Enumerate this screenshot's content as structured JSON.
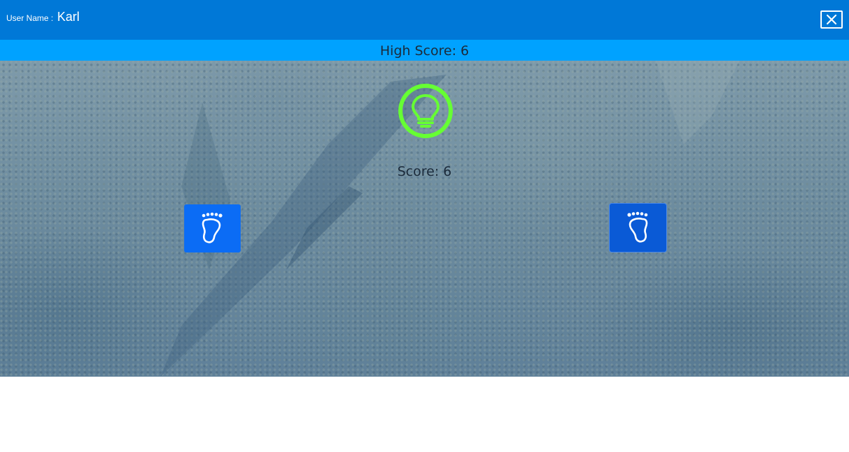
{
  "header": {
    "user_label": "User Name :",
    "user_name": "Karl",
    "close_icon": "close-icon"
  },
  "high_score": {
    "text": "High Score: 6"
  },
  "game": {
    "bulb_icon": "lightbulb-icon",
    "bulb_color": "#66ff33",
    "score_text": "Score: 6",
    "left_button_icon": "footprint-icon",
    "right_button_icon": "footprint-icon"
  },
  "colors": {
    "topbar": "#0078d7",
    "scorebar": "#00a2ff",
    "button": "#0b6cf5"
  }
}
